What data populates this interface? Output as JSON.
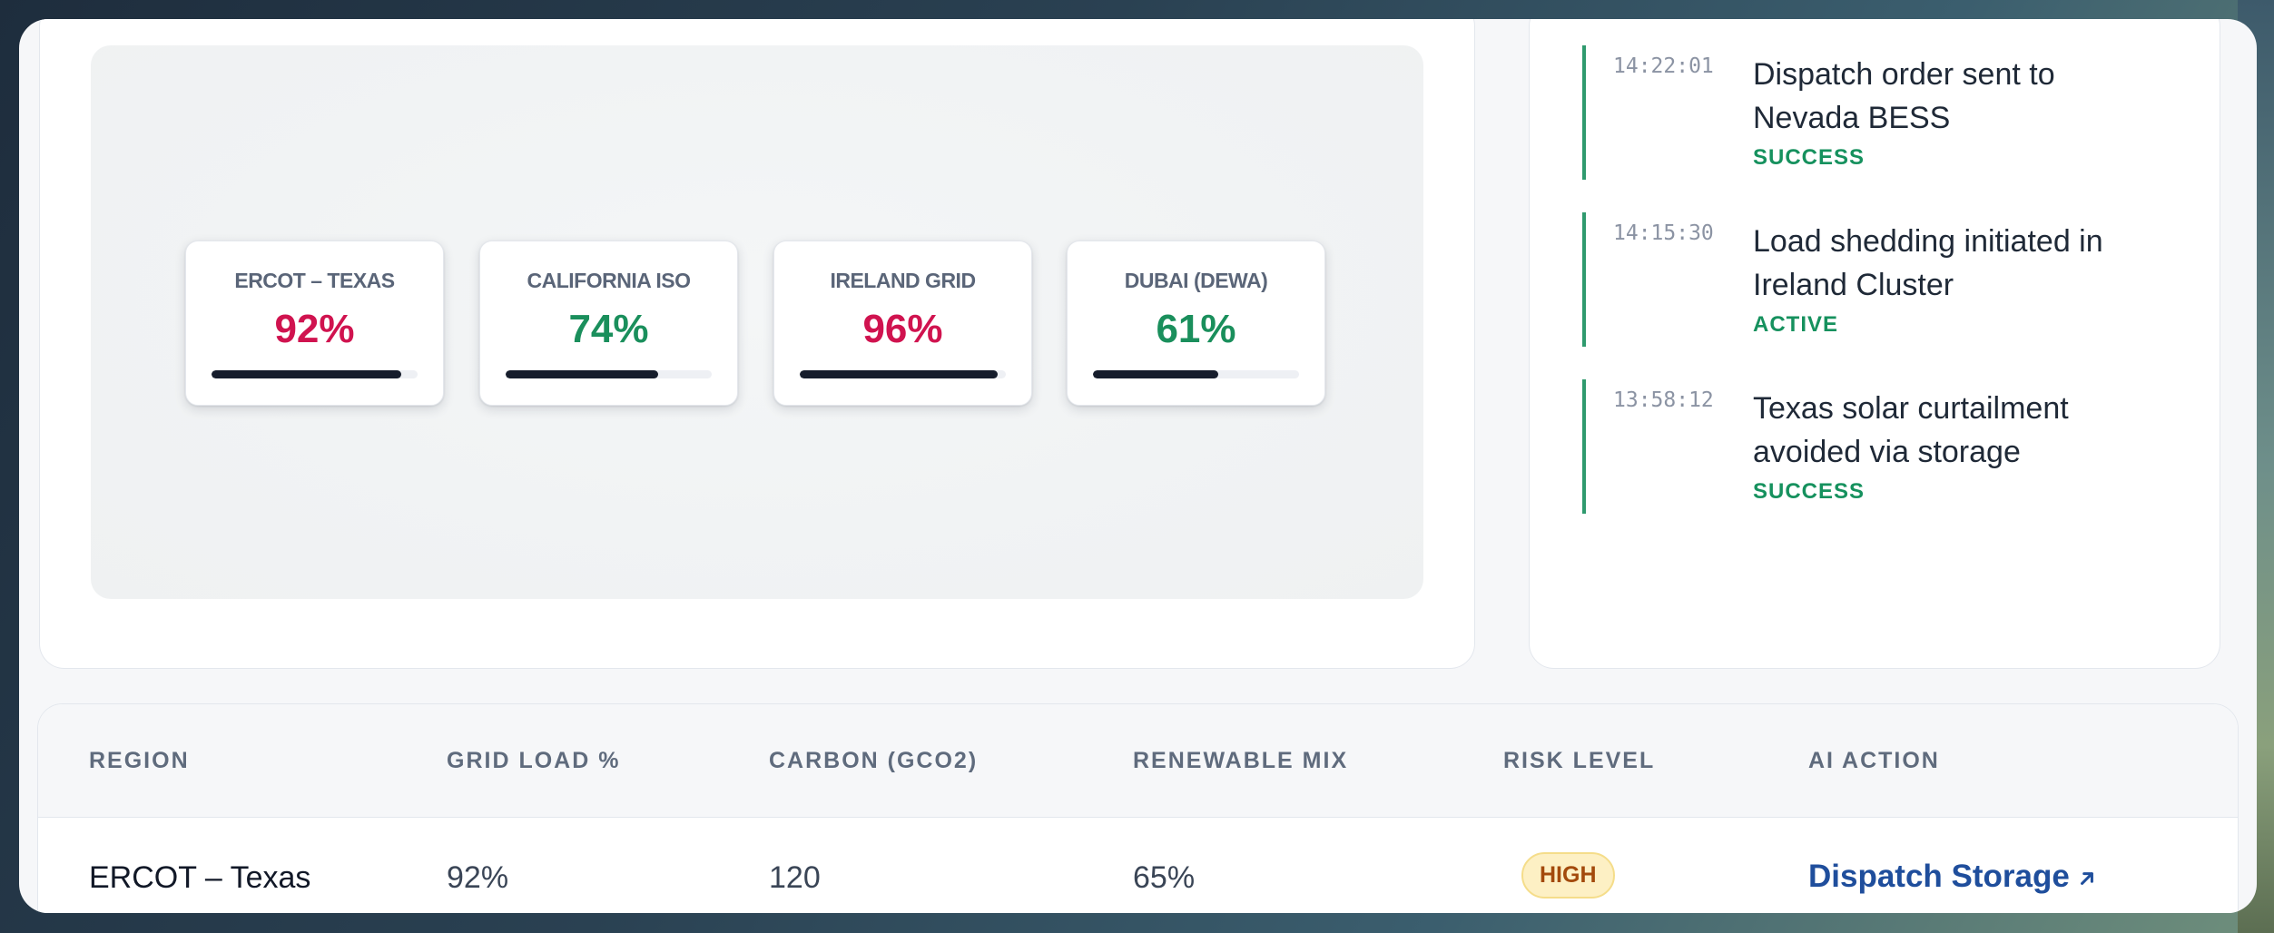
{
  "colors": {
    "high": "#d0134f",
    "ok": "#1a8f5c",
    "accent_link": "#1f4e9c",
    "feed_line": "#2f9a6e"
  },
  "gauges": [
    {
      "label": "ERCOT – TEXAS",
      "value": "92%",
      "level": 0.92,
      "status": "high"
    },
    {
      "label": "CALIFORNIA ISO",
      "value": "74%",
      "level": 0.74,
      "status": "ok"
    },
    {
      "label": "IRELAND GRID",
      "value": "96%",
      "level": 0.96,
      "status": "high"
    },
    {
      "label": "DUBAI (DEWA)",
      "value": "61%",
      "level": 0.61,
      "status": "ok"
    }
  ],
  "feed": [
    {
      "time": "14:22:01",
      "text": "Dispatch order sent to Nevada BESS",
      "status": "SUCCESS"
    },
    {
      "time": "14:15:30",
      "text": "Load shedding initiated in Ireland Cluster",
      "status": "ACTIVE"
    },
    {
      "time": "13:58:12",
      "text": "Texas solar curtailment avoided via storage",
      "status": "SUCCESS"
    }
  ],
  "table": {
    "headers": [
      "REGION",
      "GRID LOAD %",
      "CARBON (GCO2)",
      "RENEWABLE MIX",
      "RISK LEVEL",
      "AI ACTION"
    ],
    "rows": [
      {
        "region": "ERCOT – Texas",
        "load": "92%",
        "carbon": "120",
        "renewable": "65%",
        "risk": "HIGH",
        "action": "Dispatch Storage",
        "action_icon": "external-arrow-icon"
      }
    ]
  }
}
